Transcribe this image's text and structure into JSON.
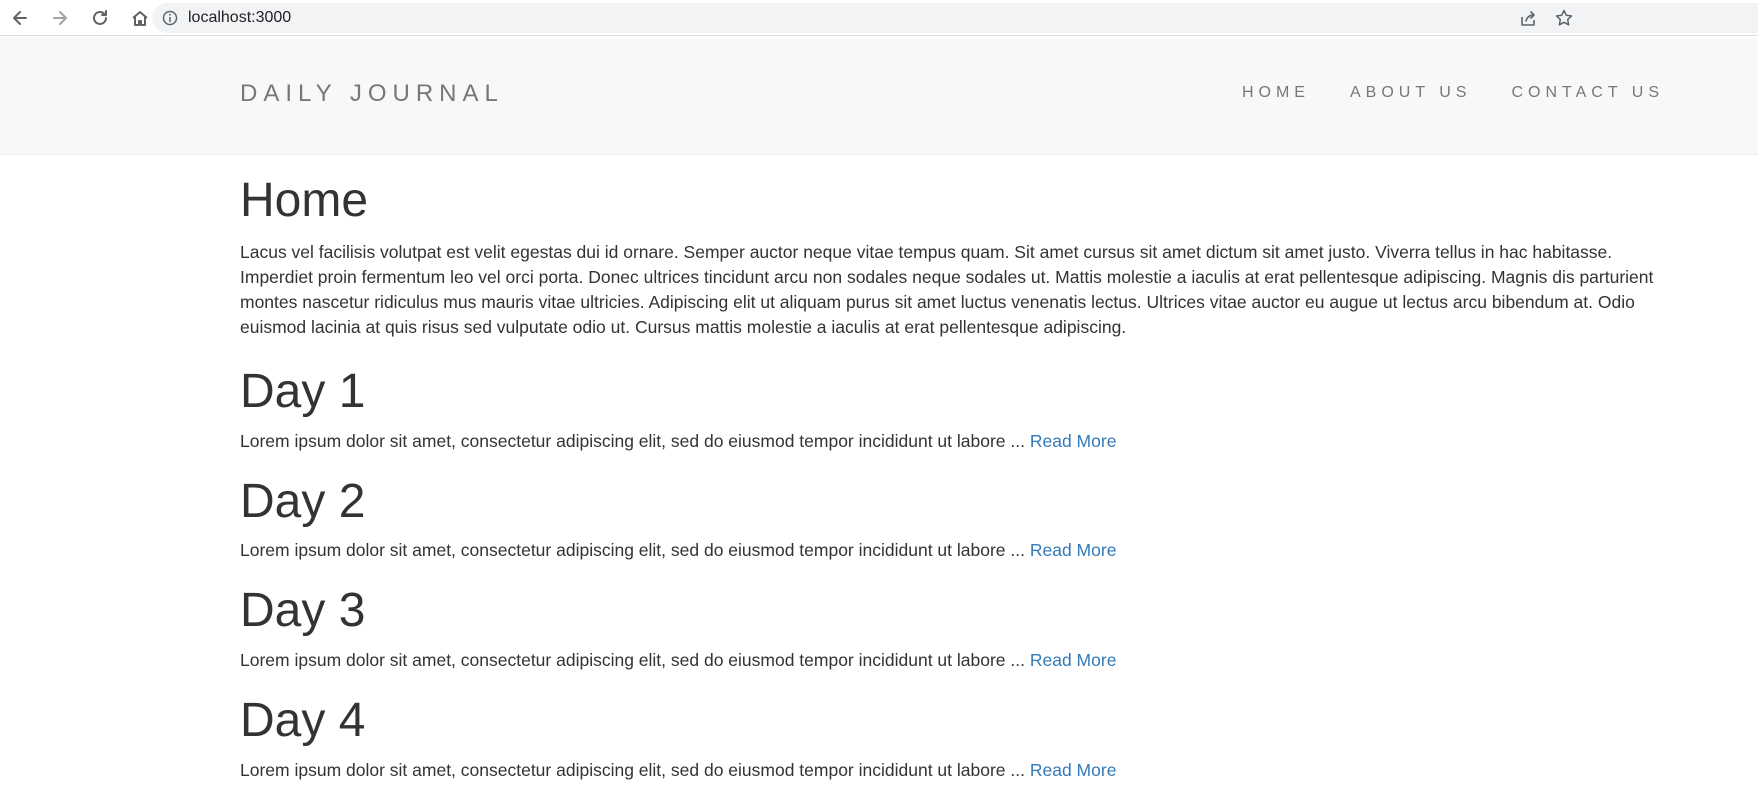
{
  "browser": {
    "url": "localhost:3000"
  },
  "navbar": {
    "brand": "DAILY JOURNAL",
    "links": [
      {
        "label": "HOME"
      },
      {
        "label": "ABOUT US"
      },
      {
        "label": "CONTACT US"
      }
    ]
  },
  "main": {
    "title": "Home",
    "intro": "Lacus vel facilisis volutpat est velit egestas dui id ornare. Semper auctor neque vitae tempus quam. Sit amet cursus sit amet dictum sit amet justo. Viverra tellus in hac habitasse. Imperdiet proin fermentum leo vel orci porta. Donec ultrices tincidunt arcu non sodales neque sodales ut. Mattis molestie a iaculis at erat pellentesque adipiscing. Magnis dis parturient montes nascetur ridiculus mus mauris vitae ultricies. Adipiscing elit ut aliquam purus sit amet luctus venenatis lectus. Ultrices vitae auctor eu augue ut lectus arcu bibendum at. Odio euismod lacinia at quis risus sed vulputate odio ut. Cursus mattis molestie a iaculis at erat pellentesque adipiscing.",
    "posts": [
      {
        "title": "Day 1",
        "excerpt": "Lorem ipsum dolor sit amet, consectetur adipiscing elit, sed do eiusmod tempor incididunt ut labore ...",
        "link": "Read More"
      },
      {
        "title": "Day 2",
        "excerpt": "Lorem ipsum dolor sit amet, consectetur adipiscing elit, sed do eiusmod tempor incididunt ut labore ...",
        "link": "Read More"
      },
      {
        "title": "Day 3",
        "excerpt": "Lorem ipsum dolor sit amet, consectetur adipiscing elit, sed do eiusmod tempor incididunt ut labore ...",
        "link": "Read More"
      },
      {
        "title": "Day 4",
        "excerpt": "Lorem ipsum dolor sit amet, consectetur adipiscing elit, sed do eiusmod tempor incididunt ut labore ...",
        "link": "Read More"
      }
    ]
  },
  "colors": {
    "navbar_bg": "#f8f8f8",
    "nav_text": "#777777",
    "body_text": "#333333",
    "link": "#337ab7"
  },
  "icons": [
    "back-arrow-icon",
    "forward-arrow-icon",
    "reload-icon",
    "home-icon",
    "info-icon",
    "share-icon",
    "star-icon"
  ]
}
